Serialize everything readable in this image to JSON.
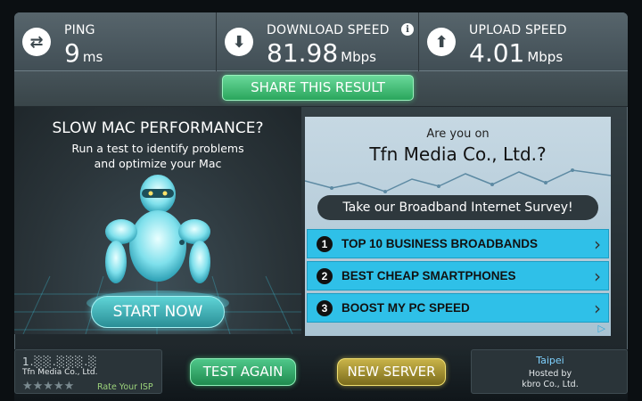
{
  "stats": {
    "ping": {
      "label": "PING",
      "value": "9",
      "unit": "ms",
      "icon": "ping-arrows-icon"
    },
    "download": {
      "label": "DOWNLOAD SPEED",
      "value": "81.98",
      "unit": "Mbps",
      "icon": "download-arrow-icon",
      "info": "i"
    },
    "upload": {
      "label": "UPLOAD SPEED",
      "value": "4.01",
      "unit": "Mbps",
      "icon": "upload-arrow-icon"
    }
  },
  "share": {
    "label": "SHARE THIS RESULT"
  },
  "promo": {
    "title": "SLOW MAC PERFORMANCE?",
    "subtitle_line1": "Run a test to identify problems",
    "subtitle_line2": "and optimize your Mac",
    "button": "START NOW"
  },
  "ad": {
    "question": "Are you on",
    "company": "Tfn Media Co., Ltd.?",
    "survey": "Take our Broadband Internet Survey!",
    "items": [
      {
        "num": "1",
        "label": "TOP 10 BUSINESS BROADBANDS"
      },
      {
        "num": "2",
        "label": "BEST CHEAP SMARTPHONES"
      },
      {
        "num": "3",
        "label": "BOOST MY PC SPEED"
      }
    ]
  },
  "bottom": {
    "isp_ip": "1.░░.░░░.░",
    "isp_name": "Tfn Media Co., Ltd.",
    "stars": "★★★★★",
    "rate_label": "Rate Your ISP",
    "test_again": "TEST AGAIN",
    "new_server": "NEW SERVER",
    "server_city": "Taipei",
    "hosted_by": "Hosted by",
    "server_isp": "kbro Co., Ltd."
  },
  "colors": {
    "accent_green": "#2aa55c",
    "accent_yellow": "#c9b449",
    "ad_item_blue": "#2fc0e8"
  }
}
